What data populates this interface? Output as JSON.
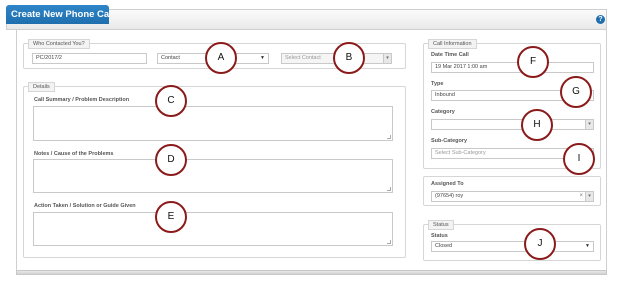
{
  "header": {
    "title": "Create New Phone Call",
    "help_icon": "?"
  },
  "who_contacted": {
    "legend": "Who Contacted You?",
    "reference_value": "PC/2017/2",
    "contact_type_value": "Contact",
    "contact_placeholder": "Select Contact"
  },
  "details": {
    "legend": "Details",
    "call_summary_label": "Call Summary / Problem Description",
    "notes_label": "Notes / Cause of the Problems",
    "action_label": "Action Taken / Solution or Guide Given"
  },
  "call_information": {
    "legend": "Call Information",
    "date_time_label": "Date Time Call",
    "date_time_value": "19 Mar 2017 1:00 am",
    "type_label": "Type",
    "type_value": "Inbound",
    "category_label": "Category",
    "category_value": "",
    "subcategory_label": "Sub-Category",
    "subcategory_placeholder": "Select Sub-Category"
  },
  "assigned": {
    "label": "Assigned To",
    "value": "(97654) roy"
  },
  "status": {
    "legend": "Status",
    "label": "Status",
    "value": "Closed"
  },
  "markers": [
    "A",
    "B",
    "C",
    "D",
    "E",
    "F",
    "G",
    "H",
    "I",
    "J"
  ],
  "colors": {
    "header_blue": "#1f6fae",
    "marker_ring": "#8b1a1a"
  }
}
